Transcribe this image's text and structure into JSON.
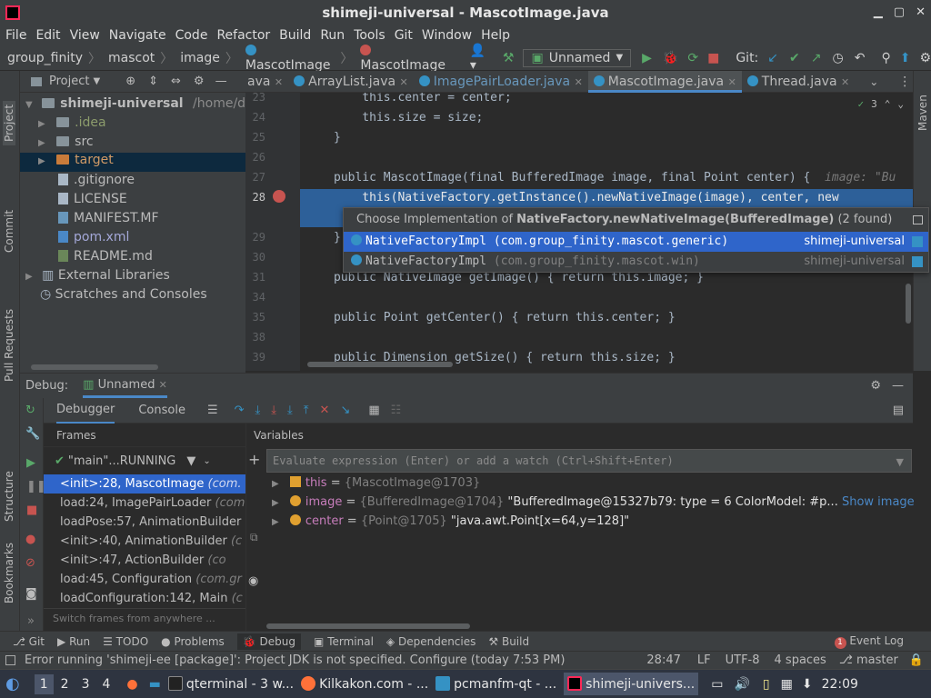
{
  "window": {
    "title": "shimeji-universal - MascotImage.java"
  },
  "menu": [
    "File",
    "Edit",
    "View",
    "Navigate",
    "Code",
    "Refactor",
    "Build",
    "Run",
    "Tools",
    "Git",
    "Window",
    "Help"
  ],
  "nav": {
    "crumbs": [
      "group_finity",
      "mascot",
      "image",
      "MascotImage",
      "MascotImage"
    ],
    "run_config": "Unnamed",
    "git_label": "Git:"
  },
  "left_strip": [
    "Project",
    "Commit",
    "Pull Requests",
    "Structure",
    "Bookmarks"
  ],
  "right_strip": [
    "Maven"
  ],
  "project": {
    "header": "Project",
    "items": [
      {
        "label": "shimeji-universal",
        "path": "/home/dartz",
        "type": "module"
      },
      {
        "label": ".idea",
        "type": "folder"
      },
      {
        "label": "src",
        "type": "folder"
      },
      {
        "label": "target",
        "type": "folder-excluded"
      },
      {
        "label": ".gitignore",
        "type": "file"
      },
      {
        "label": "LICENSE",
        "type": "file"
      },
      {
        "label": "MANIFEST.MF",
        "type": "file"
      },
      {
        "label": "pom.xml",
        "type": "file"
      },
      {
        "label": "README.md",
        "type": "file"
      },
      {
        "label": "External Libraries",
        "type": "lib"
      },
      {
        "label": "Scratches and Consoles",
        "type": "scratch"
      }
    ]
  },
  "editor": {
    "tabs": [
      "ava",
      "ArrayList.java",
      "ImagePairLoader.java",
      "MascotImage.java",
      "Thread.java"
    ],
    "active_tab": "MascotImage.java",
    "inspection_count": "3",
    "lines": [
      {
        "num": "23",
        "text": "    this.center = center;"
      },
      {
        "num": "24",
        "text": "    this.size = size;"
      },
      {
        "num": "25",
        "text": "}"
      },
      {
        "num": "26",
        "text": ""
      },
      {
        "num": "27",
        "text": "public MascotImage(final BufferedImage image, final Point center) {",
        "hint": "image: \"Bu"
      },
      {
        "num": "28",
        "text": "    this(NativeFactory.getInstance().newNativeImage(image), center, new"
      },
      {
        "num": "29",
        "text": "}"
      },
      {
        "num": "30",
        "text": ""
      },
      {
        "num": "31",
        "text": "public NativeImage getImage() { return this.image; }"
      },
      {
        "num": "34",
        "text": ""
      },
      {
        "num": "35",
        "text": "public Point getCenter() { return this.center; }"
      },
      {
        "num": "38",
        "text": ""
      },
      {
        "num": "39",
        "text": "public Dimension getSize() { return this.size; }"
      }
    ]
  },
  "popup": {
    "title_prefix": "Choose Implementation of ",
    "title_method": "NativeFactory.newNativeImage(BufferedImage)",
    "title_suffix": " (2 found)",
    "items": [
      {
        "name": "NativeFactoryImpl",
        "pkg": "(com.group_finity.mascot.generic)",
        "module": "shimeji-universal"
      },
      {
        "name": "NativeFactoryImpl",
        "pkg": "(com.group_finity.mascot.win)",
        "module": "shimeji-universal"
      }
    ]
  },
  "debug": {
    "label": "Debug:",
    "config": "Unnamed",
    "tabs": [
      "Debugger",
      "Console"
    ],
    "frames_header": "Frames",
    "variables_header": "Variables",
    "thread": "\"main\"...RUNNING",
    "frames": [
      {
        "method": "<init>:28, MascotImage",
        "cls": "(com."
      },
      {
        "method": "load:24, ImagePairLoader",
        "cls": "(com"
      },
      {
        "method": "loadPose:57, AnimationBuilder",
        "cls": ""
      },
      {
        "method": "<init>:40, AnimationBuilder",
        "cls": "(c"
      },
      {
        "method": "<init>:47, ActionBuilder",
        "cls": "(co"
      },
      {
        "method": "load:45, Configuration",
        "cls": "(com.gr"
      },
      {
        "method": "loadConfiguration:142, Main",
        "cls": "(c"
      }
    ],
    "frames_footer": "Switch frames from anywhere ...",
    "eval_placeholder": "Evaluate expression (Enter) or add a watch (Ctrl+Shift+Enter)",
    "variables": [
      {
        "name": "this",
        "value": "{MascotImage@1703}",
        "extra": ""
      },
      {
        "name": "image",
        "value": "{BufferedImage@1704}",
        "extra": "\"BufferedImage@15327b79: type = 6 ColorModel: #p...",
        "link": "Show image"
      },
      {
        "name": "center",
        "value": "{Point@1705}",
        "extra": "\"java.awt.Point[x=64,y=128]\""
      }
    ]
  },
  "toolwindows": [
    "Git",
    "Run",
    "TODO",
    "Problems",
    "Debug",
    "Terminal",
    "Dependencies",
    "Build"
  ],
  "event_log": {
    "count": "1",
    "label": "Event Log"
  },
  "status": {
    "message": "Error running 'shimeji-ee [package]': Project JDK is not specified. Configure (today 7:53 PM)",
    "position": "28:47",
    "line_sep": "LF",
    "encoding": "UTF-8",
    "indent": "4 spaces",
    "branch": "master"
  },
  "taskbar": {
    "workspaces": [
      "1",
      "2",
      "3",
      "4"
    ],
    "tasks": [
      "qterminal - 3 w...",
      "Kilkakon.com - ...",
      "pcmanfm-qt - ...",
      "shimeji-univers..."
    ],
    "clock": "22:09"
  }
}
